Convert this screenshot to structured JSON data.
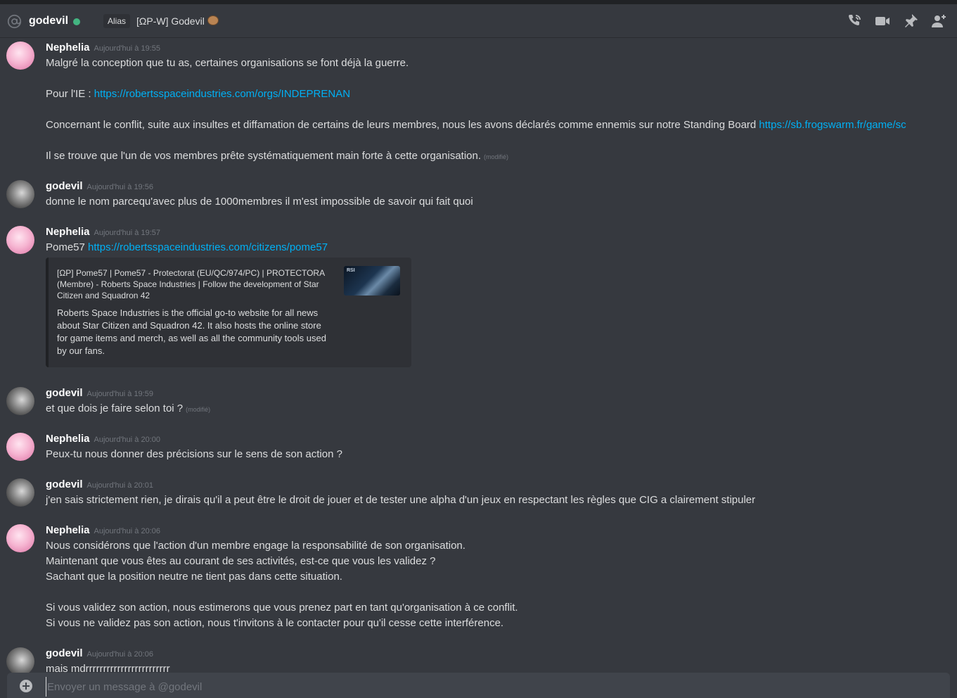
{
  "header": {
    "username": "godevil",
    "status_color": "#43b581",
    "alias_badge": "Alias",
    "alias_value": "[ΩP-W] Godevil",
    "icons": [
      "phone-call-icon",
      "video-camera-icon",
      "pin-icon",
      "add-friend-icon"
    ]
  },
  "messages": [
    {
      "author": "Nephelia",
      "timestamp": "Aujourd'hui à 19:55",
      "lines": [
        {
          "text": "Malgré la conception que tu as, certaines organisations se font déjà la guerre."
        },
        {
          "text": ""
        },
        {
          "text": "Pour l'IE : ",
          "link": "https://robertsspaceindustries.com/orgs/INDEPRENAN"
        },
        {
          "text": ""
        },
        {
          "text": "Concernant le conflit, suite aux insultes et diffamation de certains de leurs membres, nous les avons déclarés comme ennemis sur notre Standing Board ",
          "link": "https://sb.frogswarm.fr/game/sc"
        },
        {
          "text": ""
        },
        {
          "text": "Il se trouve que l'un de vos membres prête systématiquement main forte à cette organisation.",
          "edited": "(modifié)"
        }
      ]
    },
    {
      "author": "godevil",
      "timestamp": "Aujourd'hui à 19:56",
      "lines": [
        {
          "text": "donne le nom parcequ'avec plus de 1000membres il m'est impossible de savoir qui fait quoi"
        }
      ]
    },
    {
      "author": "Nephelia",
      "timestamp": "Aujourd'hui à 19:57",
      "lines": [
        {
          "text": "Pome57 ",
          "link": "https://robertsspaceindustries.com/citizens/pome57"
        }
      ],
      "embed": {
        "title": "[ΩP] Pome57 | Pome57 - Protectorat (EU/QC/974/PC) | PROTECTORA (Membre) - Roberts Space Industries | Follow the development of Star Citizen and Squadron 42",
        "description": "Roberts Space Industries is the official go-to website for all news about Star Citizen and Squadron 42. It also hosts the online store for game items and merch, as well as all the community tools used by our fans.",
        "thumb_label": "RSI"
      }
    },
    {
      "author": "godevil",
      "timestamp": "Aujourd'hui à 19:59",
      "lines": [
        {
          "text": "et que dois je faire selon toi ?",
          "edited": "(modifié)"
        }
      ]
    },
    {
      "author": "Nephelia",
      "timestamp": "Aujourd'hui à 20:00",
      "lines": [
        {
          "text": "Peux-tu nous donner des précisions sur le sens de son action ?"
        }
      ]
    },
    {
      "author": "godevil",
      "timestamp": "Aujourd'hui à 20:01",
      "lines": [
        {
          "text": "j'en sais strictement rien, je dirais qu'il a peut être le droit de jouer et de tester une alpha d'un jeux en respectant les règles que CIG a clairement stipuler"
        }
      ]
    },
    {
      "author": "Nephelia",
      "timestamp": "Aujourd'hui à 20:06",
      "lines": [
        {
          "text": "Nous considérons que l'action d'un membre engage la responsabilité de son organisation."
        },
        {
          "text": "Maintenant que vous êtes au courant de ses activités, est-ce que vous les validez ?"
        },
        {
          "text": "Sachant que la position neutre ne tient pas dans cette situation."
        },
        {
          "text": ""
        },
        {
          "text": "Si vous validez son action, nous estimerons que vous prenez part en tant qu'organisation à ce conflit."
        },
        {
          "text": "Si vous ne validez pas son action, nous t'invitons à le contacter pour qu'il cesse cette interférence."
        }
      ]
    },
    {
      "author": "godevil",
      "timestamp": "Aujourd'hui à 20:06",
      "lines": [
        {
          "text": "mais mdrrrrrrrrrrrrrrrrrrrrrrrr"
        }
      ]
    }
  ],
  "composer": {
    "placeholder": "Envoyer un message à @godevil"
  }
}
